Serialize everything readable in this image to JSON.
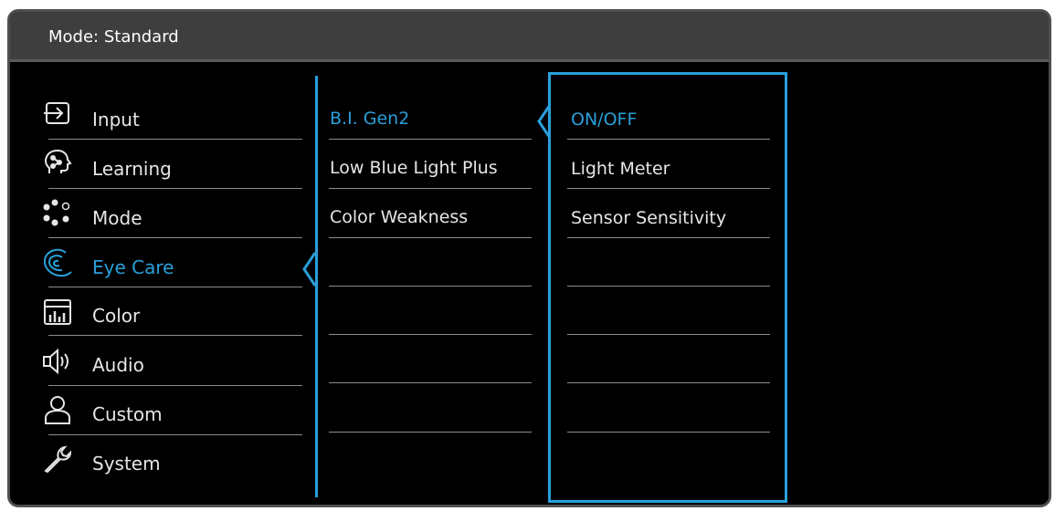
{
  "header": {
    "mode_label": "Mode: Standard"
  },
  "menu": {
    "items": [
      {
        "label": "Input",
        "icon": "input-icon",
        "selected": false
      },
      {
        "label": "Learning",
        "icon": "learning-icon",
        "selected": false
      },
      {
        "label": "Mode",
        "icon": "mode-icon",
        "selected": false
      },
      {
        "label": "Eye Care",
        "icon": "eye-care-icon",
        "selected": true
      },
      {
        "label": "Color",
        "icon": "color-icon",
        "selected": false
      },
      {
        "label": "Audio",
        "icon": "audio-icon",
        "selected": false
      },
      {
        "label": "Custom",
        "icon": "custom-icon",
        "selected": false
      },
      {
        "label": "System",
        "icon": "system-icon",
        "selected": false
      }
    ]
  },
  "submenu": {
    "items": [
      "B.I. Gen2",
      "Low Blue Light Plus",
      "Color Weakness"
    ],
    "selected_index": 0
  },
  "options": {
    "items": [
      "ON/OFF",
      "Light Meter",
      "Sensor Sensitivity"
    ],
    "selected_index": 0
  },
  "colors": {
    "accent": "#2a9fd9",
    "background": "#000000",
    "header": "#3e3e3e",
    "text": "#e6e6e6"
  }
}
